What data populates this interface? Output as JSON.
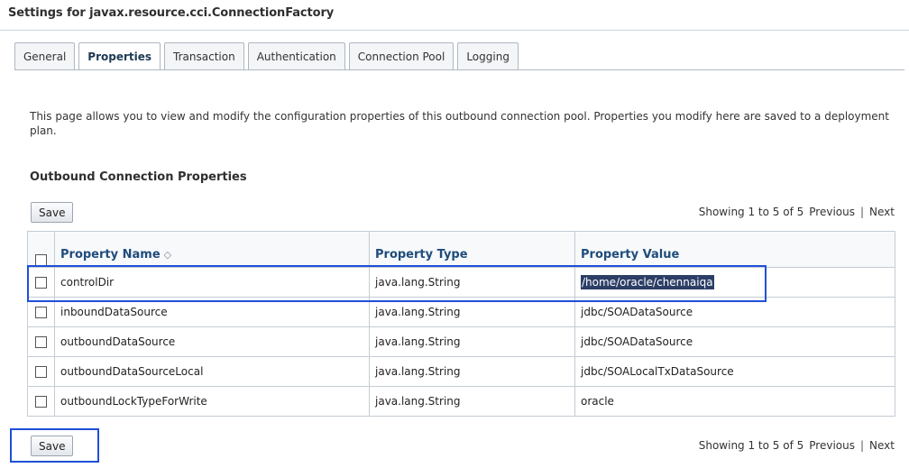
{
  "page": {
    "title": "Settings for javax.resource.cci.ConnectionFactory"
  },
  "tabs": [
    {
      "label": "General"
    },
    {
      "label": "Properties",
      "active": true
    },
    {
      "label": "Transaction"
    },
    {
      "label": "Authentication"
    },
    {
      "label": "Connection Pool"
    },
    {
      "label": "Logging"
    }
  ],
  "description": "This page allows you to view and modify the configuration properties of this outbound connection pool. Properties you modify here are saved to a deployment plan.",
  "section_title": "Outbound Connection Properties",
  "toolbar": {
    "save_label": "Save",
    "showing": "Showing 1 to 5 of 5",
    "previous": "Previous",
    "separator": "|",
    "next": "Next"
  },
  "table": {
    "headers": {
      "name": "Property Name",
      "type": "Property Type",
      "value": "Property Value"
    },
    "sort_icon": "sort-ascending-icon",
    "rows": [
      {
        "name": "controlDir",
        "type": "java.lang.String",
        "value": "/home/oracle/chennaiqa"
      },
      {
        "name": "inboundDataSource",
        "type": "java.lang.String",
        "value": "jdbc/SOADataSource"
      },
      {
        "name": "outboundDataSource",
        "type": "java.lang.String",
        "value": "jdbc/SOADataSource"
      },
      {
        "name": "outboundDataSourceLocal",
        "type": "java.lang.String",
        "value": "jdbc/SOALocalTxDataSource"
      },
      {
        "name": "outboundLockTypeForWrite",
        "type": "java.lang.String",
        "value": "oracle"
      }
    ]
  },
  "colors": {
    "highlight_box": "#1e50d8",
    "selected_text_bg": "#2c3e66",
    "header_text": "#1f4c7a"
  }
}
